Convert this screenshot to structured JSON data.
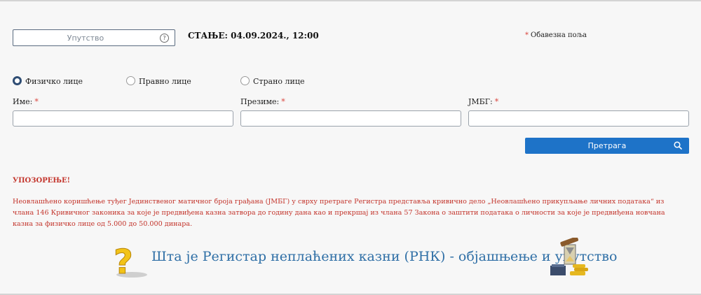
{
  "header": {
    "guide_label": "Упутство",
    "status": "СТАЊЕ: 04.09.2024., 12:00",
    "required_star": "*",
    "required_note": "Обавезна поља"
  },
  "person_types": [
    {
      "label": "Физичко лице",
      "checked": true
    },
    {
      "label": "Правно лице",
      "checked": false
    },
    {
      "label": "Страно лице",
      "checked": false
    }
  ],
  "fields": {
    "first_name_label": "Име:",
    "last_name_label": "Презиме:",
    "jmbg_label": "ЈМБГ:",
    "star": "*",
    "first_name_value": "",
    "last_name_value": "",
    "jmbg_value": ""
  },
  "search": {
    "label": "Претрага"
  },
  "warning": {
    "title": "УПОЗОРЕЊЕ!",
    "text": "Неовлашћено коришћење туђег Јединственог матичног броја грађана (ЈМБГ) у сврху претраге Регистра представља кривично дело „Неовлашћено прикупљање личних података“ из члана 146 Кривичног законика за које је предвиђена казна затвора до годину дана као и прекршај из члана 57 Закона о заштити података о личности за које је предвиђена новчана казна за физичко лице од 5.000 до 50.000 динара."
  },
  "banner": {
    "text": "Шта је Регистар неплаћених казни (РНК) - објашњење и упутство"
  },
  "colors": {
    "accent": "#1e73c8",
    "warning": "#c3342b",
    "required": "#d9443d",
    "banner_text": "#2f6fa6"
  },
  "icons": [
    "question-circle-icon",
    "search-icon",
    "question-mark-icon",
    "justice-gavel-icon"
  ]
}
